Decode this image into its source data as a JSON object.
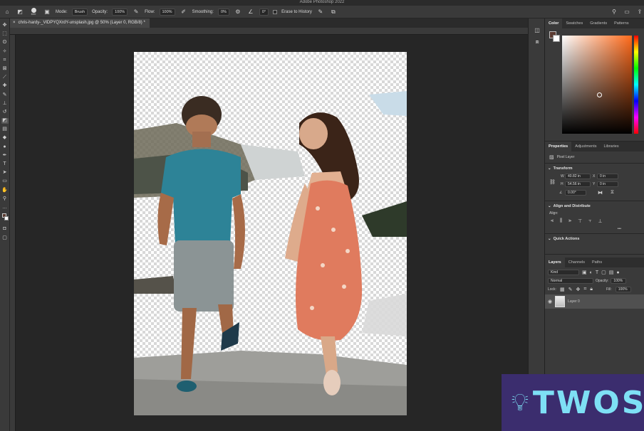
{
  "app": {
    "title": "Adobe Photoshop 2022"
  },
  "options": {
    "brush_size": "600",
    "mode_label": "Mode:",
    "mode_value": "Brush",
    "opacity_label": "Opacity:",
    "opacity_value": "100%",
    "flow_label": "Flow:",
    "flow_value": "100%",
    "smoothing_label": "Smoothing:",
    "smoothing_value": "0%",
    "angle_value": "0°",
    "erase_history_label": "Erase to History"
  },
  "document": {
    "tab_title": "chris-hardy-_VlDPYQXrdY-unsplash.jpg @ 50% (Layer 0, RGB/8) *",
    "close_glyph": "×"
  },
  "color_panel": {
    "tabs": [
      "Color",
      "Swatches",
      "Gradients",
      "Patterns"
    ],
    "foreground": "#5a3a30",
    "background": "#ffffff",
    "hue": "#ff6a1a"
  },
  "properties_panel": {
    "tabs": [
      "Properties",
      "Adjustments",
      "Libraries"
    ],
    "layer_type": "Pixel Layer",
    "transform_title": "Transform",
    "w_label": "W",
    "w_value": "40.82 in",
    "h_label": "H",
    "h_value": "54.56 in",
    "x_label": "X",
    "x_value": "0 in",
    "y_label": "Y",
    "y_value": "0 in",
    "angle_value": "0.00°",
    "align_title": "Align and Distribute",
    "align_label": "Align:",
    "more_glyph": "•••",
    "quick_actions_title": "Quick Actions"
  },
  "layers_panel": {
    "tabs": [
      "Layers",
      "Channels",
      "Paths"
    ],
    "kind_label": "Kind",
    "blend_mode": "Normal",
    "opacity_label": "Opacity:",
    "opacity_value": "100%",
    "lock_label": "Lock:",
    "fill_label": "Fill:",
    "fill_value": "100%",
    "layers": [
      {
        "name": "Layer 0",
        "visible": true
      }
    ]
  },
  "watermark": {
    "text": "TWOS"
  }
}
